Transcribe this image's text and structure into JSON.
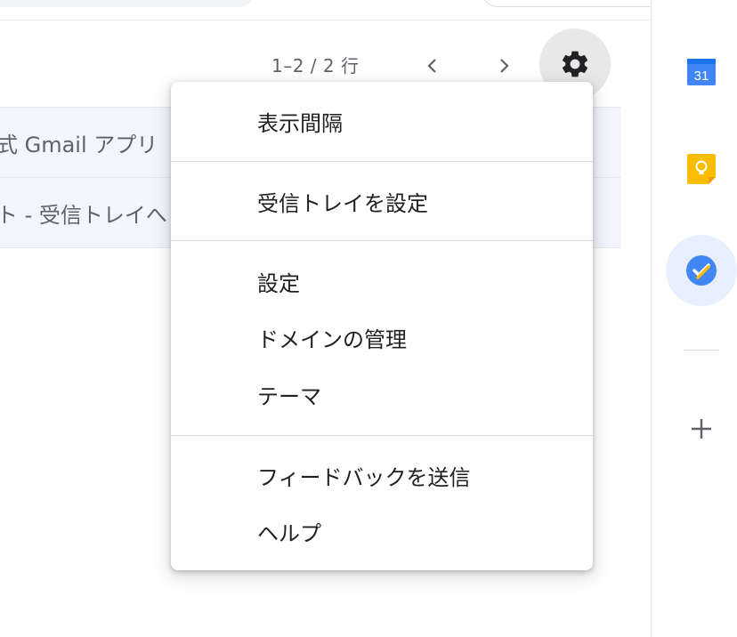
{
  "toolbar": {
    "pagination": "1–2 / 2 行",
    "prev_icon": "chevron-left-icon",
    "next_icon": "chevron-right-icon",
    "settings_icon": "gear-icon"
  },
  "email_rows": [
    {
      "text": "式 Gmail アプリ"
    },
    {
      "text": "ト - 受信トレイへ"
    }
  ],
  "settings_menu": {
    "sections": [
      [
        "表示間隔"
      ],
      [
        "受信トレイを設定"
      ],
      [
        "設定",
        "ドメインの管理",
        "テーマ"
      ],
      [
        "フィードバックを送信",
        "ヘルプ"
      ]
    ]
  },
  "side_panel": {
    "calendar_day": "31",
    "icons": [
      "calendar-icon",
      "keep-icon",
      "tasks-icon",
      "add-icon"
    ],
    "colors": {
      "calendar": "#4285f4",
      "keep": "#fbbc04",
      "tasks": "#4285f4",
      "active_bg": "#e8f0fe"
    }
  }
}
